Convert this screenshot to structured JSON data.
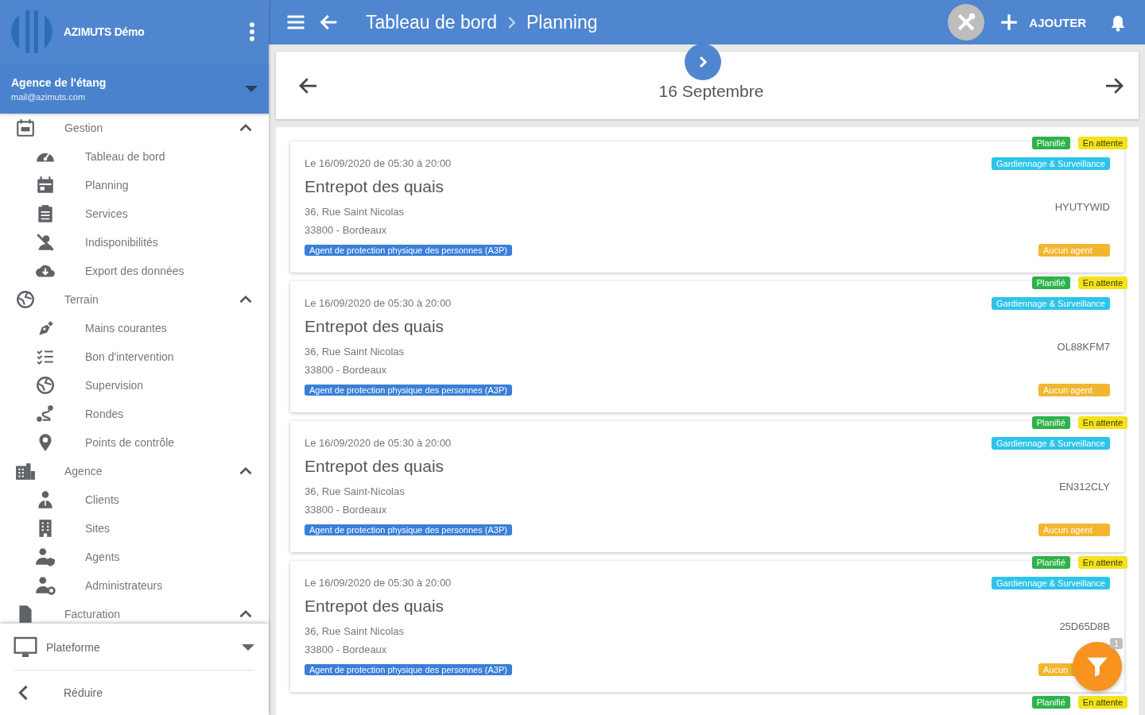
{
  "app": {
    "name": "AZIMUTS Démo"
  },
  "agency": {
    "name": "Agence de l'étang",
    "email": "mail@azimuts.com"
  },
  "sidebar": {
    "groups": [
      {
        "label": "Gestion",
        "expanded": true,
        "items": [
          {
            "label": "Tableau de bord"
          },
          {
            "label": "Planning"
          },
          {
            "label": "Services"
          },
          {
            "label": "Indisponibilités"
          },
          {
            "label": "Export des données"
          }
        ]
      },
      {
        "label": "Terrain",
        "expanded": true,
        "items": [
          {
            "label": "Mains courantes"
          },
          {
            "label": "Bon d'intervention"
          },
          {
            "label": "Supervision"
          },
          {
            "label": "Rondes"
          },
          {
            "label": "Points de contrôle"
          }
        ]
      },
      {
        "label": "Agence",
        "expanded": true,
        "items": [
          {
            "label": "Clients"
          },
          {
            "label": "Sites"
          },
          {
            "label": "Agents"
          },
          {
            "label": "Administrateurs"
          }
        ]
      },
      {
        "label": "Facturation",
        "expanded": true
      }
    ]
  },
  "footer": {
    "platform": "Plateforme",
    "collapse": "Réduire"
  },
  "topbar": {
    "breadcrumb": [
      "Tableau de bord",
      "Planning"
    ],
    "add_label": "AJOUTER"
  },
  "date_nav": {
    "label": "16 Septembre"
  },
  "missions": [
    {
      "statuses": [
        {
          "label": "Planifié",
          "color": "#2db34a"
        },
        {
          "label": "En attente",
          "color": "#f4e21c"
        }
      ],
      "date_line": "Le 16/09/2020 de 05:30 à 20:00",
      "title": "Entrepot des quais",
      "address": "36, Rue Saint Nicolas",
      "city": "33800 - Bordeaux",
      "qualification": {
        "label": "Agent de protection physique des personnes (A3P)",
        "color": "#3a7fd8"
      },
      "category": {
        "label": "Gardiennage & Surveillance",
        "color": "#2ec4ea"
      },
      "code": "HYUTYWID",
      "assignment": {
        "label": "Aucun agent",
        "color": "#f2b630"
      }
    },
    {
      "statuses": [
        {
          "label": "Planifié",
          "color": "#2db34a"
        },
        {
          "label": "En attente",
          "color": "#f4e21c"
        }
      ],
      "date_line": "Le 16/09/2020 de 05:30 à 20:00",
      "title": "Entrepot des quais",
      "address": "36, Rue Saint Nicolas",
      "city": "33800 - Bordeaux",
      "qualification": {
        "label": "Agent de protection physique des personnes (A3P)",
        "color": "#3a7fd8"
      },
      "category": {
        "label": "Gardiennage & Surveillance",
        "color": "#2ec4ea"
      },
      "code": "OL88KFM7",
      "assignment": {
        "label": "Aucun agent",
        "color": "#f2b630"
      }
    },
    {
      "statuses": [
        {
          "label": "Planifié",
          "color": "#2db34a"
        },
        {
          "label": "En attente",
          "color": "#f4e21c"
        }
      ],
      "date_line": "Le 16/09/2020 de 05:30 à 20:00",
      "title": "Entrepot des quais",
      "address": "36, Rue Saint-Nicolas",
      "city": "33800 - Bordeaux",
      "qualification": {
        "label": "Agent de protection physique des personnes (A3P)",
        "color": "#3a7fd8"
      },
      "category": {
        "label": "Gardiennage & Surveillance",
        "color": "#2ec4ea"
      },
      "code": "EN312CLY",
      "assignment": {
        "label": "Aucun agent",
        "color": "#f2b630"
      }
    },
    {
      "statuses": [
        {
          "label": "Planifié",
          "color": "#2db34a"
        },
        {
          "label": "En attente",
          "color": "#f4e21c"
        }
      ],
      "date_line": "Le 16/09/2020 de 05:30 à 20:00",
      "title": "Entrepot des quais",
      "address": "36, Rue Saint Nicolas",
      "city": "33800 - Bordeaux",
      "qualification": {
        "label": "Agent de protection physique des personnes (A3P)",
        "color": "#3a7fd8"
      },
      "category": {
        "label": "Gardiennage & Surveillance",
        "color": "#2ec4ea"
      },
      "code": "25D65D8B",
      "assignment": {
        "label": "Aucun",
        "color": "#f2b630"
      }
    },
    {
      "statuses": [
        {
          "label": "Planifié",
          "color": "#2db34a"
        },
        {
          "label": "En attente",
          "color": "#f4e21c"
        }
      ]
    }
  ],
  "filter": {
    "count": "1"
  }
}
